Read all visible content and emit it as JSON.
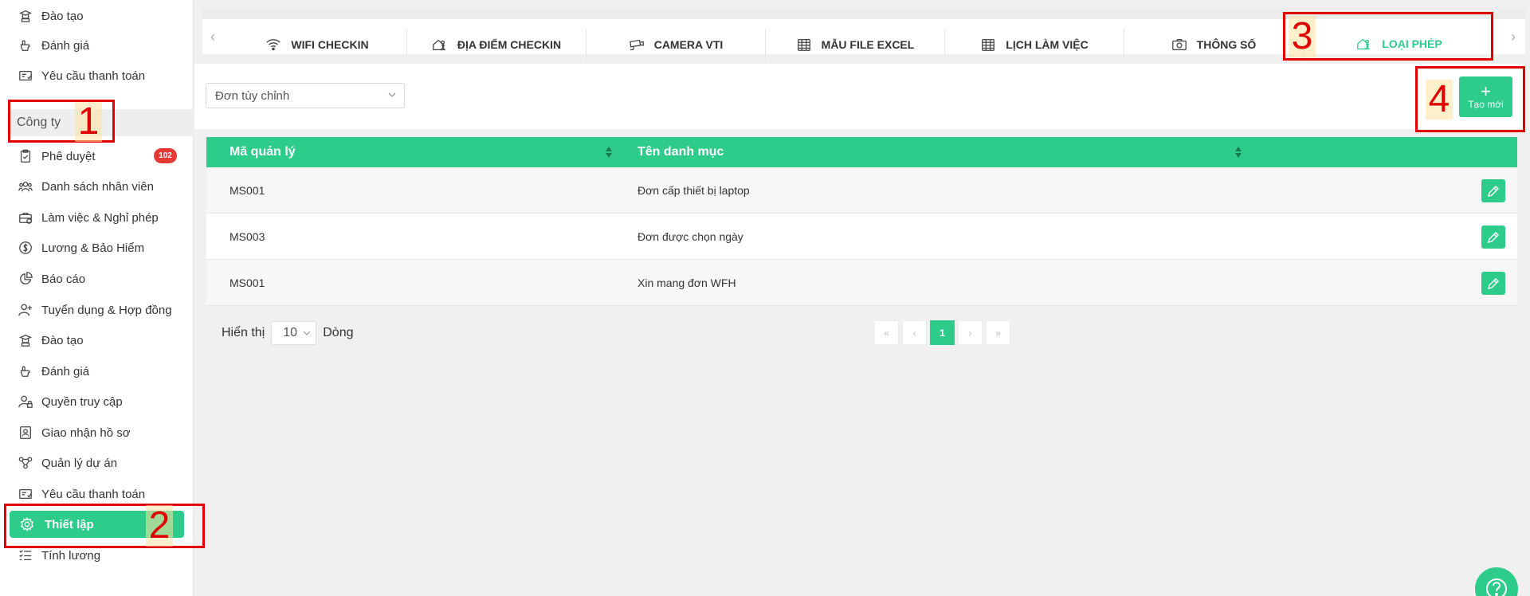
{
  "sidebar": {
    "top_items": [
      {
        "label": "Đào tạo",
        "icon": "training-icon"
      },
      {
        "label": "Đánh giá",
        "icon": "evaluation-icon"
      },
      {
        "label": "Yêu cầu thanh toán",
        "icon": "payment-request-icon"
      }
    ],
    "section_title": "Công ty",
    "items": [
      {
        "label": "Phê duyệt",
        "icon": "approval-icon",
        "badge": "102"
      },
      {
        "label": "Danh sách nhân viên",
        "icon": "employees-icon"
      },
      {
        "label": "Làm việc & Nghỉ phép",
        "icon": "work-leave-icon"
      },
      {
        "label": "Lương & Bảo Hiểm",
        "icon": "salary-icon"
      },
      {
        "label": "Báo cáo",
        "icon": "report-icon"
      },
      {
        "label": "Tuyển dụng & Hợp đồng",
        "icon": "recruitment-icon"
      },
      {
        "label": "Đào tạo",
        "icon": "training-icon"
      },
      {
        "label": "Đánh giá",
        "icon": "evaluation-icon"
      },
      {
        "label": "Quyền truy cập",
        "icon": "access-icon"
      },
      {
        "label": "Giao nhận hồ sơ",
        "icon": "documents-icon"
      },
      {
        "label": "Quản lý dự án",
        "icon": "project-icon"
      },
      {
        "label": "Yêu cầu thanh toán",
        "icon": "payment-request-icon"
      },
      {
        "label": "Thiết lập",
        "icon": "gear-icon",
        "active": true
      },
      {
        "label": "Tính lương",
        "icon": "payroll-icon"
      }
    ]
  },
  "annotations": [
    "1",
    "2",
    "3",
    "4"
  ],
  "tabs": [
    {
      "label": "WIFI CHECKIN",
      "icon": "wifi-icon"
    },
    {
      "label": "ĐỊA ĐIỂM CHECKIN",
      "icon": "location-checkin-icon"
    },
    {
      "label": "CAMERA VTI",
      "icon": "camera-icon"
    },
    {
      "label": "MẪU FILE EXCEL",
      "icon": "calendar-grid-icon"
    },
    {
      "label": "LỊCH LÀM VIỆC",
      "icon": "calendar-grid-icon"
    },
    {
      "label": "THÔNG SỐ",
      "icon": "photo-camera-icon"
    },
    {
      "label": "LOẠI PHÉP",
      "icon": "leave-type-icon",
      "active": true
    }
  ],
  "filter": {
    "selected": "Đơn tùy chỉnh"
  },
  "create_button": {
    "label": "Tạo mới"
  },
  "table": {
    "columns": [
      "Mã quản lý",
      "Tên danh mục"
    ],
    "rows": [
      [
        "MS001",
        "Đơn cấp thiết bị laptop"
      ],
      [
        "MS003",
        "Đơn được chọn ngày"
      ],
      [
        "MS001",
        "Xin mang đơn WFH"
      ]
    ]
  },
  "pagination": {
    "show_label": "Hiển thị",
    "page_size": "10",
    "rows_label": "Dòng",
    "pages": [
      "«",
      "‹",
      "1",
      "›",
      "»"
    ],
    "current": "1"
  },
  "colors": {
    "accent": "#2ecc8a",
    "badge": "#e53935",
    "annotation": "#e00000"
  }
}
